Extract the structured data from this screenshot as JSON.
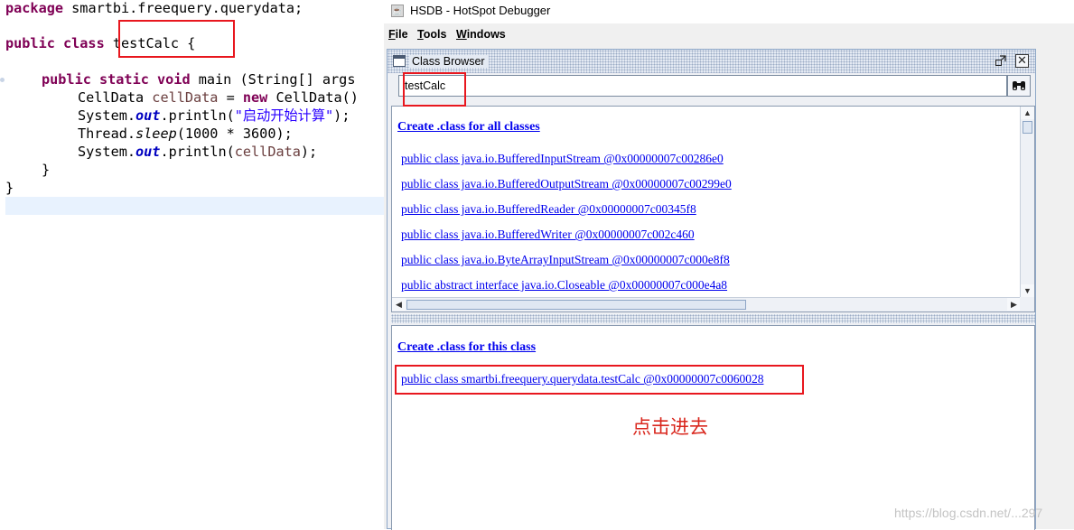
{
  "editor": {
    "lines": {
      "l1": {
        "kw": "package",
        "rest": " smartbi.freequery.querydata;"
      },
      "l2": {
        "kw": "public class",
        "sp": " ",
        "name": "testCalc {"
      },
      "l3": {
        "kw": "public static void",
        "rest": " main (String[] args"
      },
      "l4": {
        "a": "CellData ",
        "var": "cellData",
        "b": " = ",
        "kw": "new",
        "c": " CellData()"
      },
      "l5": {
        "a": "System.",
        "fld": "out",
        "b": ".println(",
        "str": "\"启动开始计算\"",
        "c": ");"
      },
      "l6": {
        "a": "Thread.",
        "ital": "sleep",
        "b": "(1000 * 3600);"
      },
      "l7": {
        "a": "System.",
        "fld": "out",
        "b": ".println(",
        "var": "cellData",
        "c": ");"
      },
      "l8": "}",
      "l9": "}"
    }
  },
  "window": {
    "title": "HSDB - HotSpot Debugger",
    "menu": {
      "file": {
        "u": "F",
        "rest": "ile"
      },
      "tools": {
        "u": "T",
        "rest": "ools"
      },
      "windows": {
        "u": "W",
        "rest": "indows"
      }
    }
  },
  "class_browser": {
    "title": "Class Browser",
    "search_value": "testCalc",
    "create_all_label": "Create .class for all classes",
    "classes": [
      "public class java.io.BufferedInputStream @0x00000007c00286e0",
      "public class java.io.BufferedOutputStream @0x00000007c00299e0",
      "public class java.io.BufferedReader @0x00000007c00345f8",
      "public class java.io.BufferedWriter @0x00000007c002c460",
      "public class java.io.ByteArrayInputStream @0x00000007c000e8f8",
      "public abstract interface java.io.Closeable @0x00000007c000e4a8"
    ],
    "create_this_label": "Create .class for this class",
    "selected_class": "public class smartbi.freequery.querydata.testCalc @0x00000007c0060028"
  },
  "annotation": "点击进去",
  "watermark": "https://blog.csdn.net/...297",
  "colors": {
    "highlight_box": "#e8171e",
    "link": "#0000ee",
    "annotation": "#d9261c"
  },
  "icons": [
    "java-app-icon",
    "frame-icon",
    "restore-icon",
    "close-icon",
    "binoculars-icon"
  ]
}
